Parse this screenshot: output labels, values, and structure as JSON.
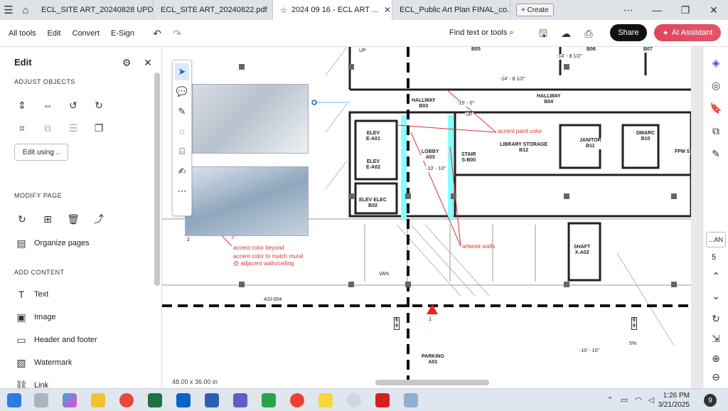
{
  "tabs": [
    {
      "label": "ECL_SITE ART_20240828 UPD...",
      "active": false
    },
    {
      "label": "ECL_SITE ART_20240822.pdf",
      "active": false
    },
    {
      "label": "2024 09 16 - ECL ART ...",
      "active": true
    },
    {
      "label": "ECL_Public Art Plan FINAL_co...",
      "active": false
    }
  ],
  "create_label": "Create",
  "toolbar": {
    "menus": [
      "All tools",
      "Edit",
      "Convert",
      "E-Sign"
    ],
    "find_label": "Find text or tools",
    "share_label": "Share",
    "ai_label": "AI Assistant"
  },
  "left_panel": {
    "title": "Edit",
    "adjust_objects": "ADJUST OBJECTS",
    "edit_using": "Edit using ..",
    "modify_page": "MODIFY PAGE",
    "organize_pages": "Organize pages",
    "add_content": "ADD CONTENT",
    "items": [
      "Text",
      "Image",
      "Header and footer",
      "Watermark",
      "Link"
    ]
  },
  "drawing": {
    "rooms": [
      {
        "name": "HALLWAY",
        "code": "B03"
      },
      {
        "name": "HALLWAY",
        "code": "B04"
      },
      {
        "name": "ELEV",
        "code": "E-A01"
      },
      {
        "name": "ELEV",
        "code": "E-A02"
      },
      {
        "name": "LOBBY",
        "code": "A03"
      },
      {
        "name": "STAIR",
        "code": "S-B00"
      },
      {
        "name": "LIBRARY STORAGE",
        "code": "B12"
      },
      {
        "name": "JANITOR",
        "code": "B11"
      },
      {
        "name": "DMARC",
        "code": "B10"
      },
      {
        "name": "FPM S",
        "code": ""
      },
      {
        "name": "ELEV ELEC",
        "code": "B02"
      },
      {
        "name": "SHAFT",
        "code": "X-A02"
      },
      {
        "name": "PARKING",
        "code": "A01"
      },
      {
        "name": "",
        "code": "B05"
      },
      {
        "name": "",
        "code": "B06"
      },
      {
        "name": "",
        "code": "B07"
      }
    ],
    "annotations": {
      "accent_paint": "accent paint color",
      "artwork_walls": "artwork walls",
      "accent_beyond": "accent color beyond",
      "accent_match": "accent color to match mural @ adjacent walls/ceiling"
    },
    "dims": [
      "-14' - 8 1/2\"",
      "-14' - 8 1/2\"",
      "-15' - 0\"",
      "-10' - 10\"",
      "-10' - 10\""
    ],
    "up_labels": [
      "UP",
      "UP"
    ],
    "misc": {
      "asi": "ASI-004",
      "van": "VAN",
      "grade": "5%",
      "marker": "1",
      "photo_num": "2",
      "grid_a": "6",
      "grid_b": "9"
    },
    "page_size": "48.00 x 36.00 in"
  },
  "right_rail": {
    "page_label": "...AN",
    "page_number": "5"
  },
  "taskbar": {
    "time": "1:26 PM",
    "date": "3/21/2025",
    "notifications": "9"
  },
  "colors": {
    "accent_red": "#dd3344",
    "ai_pink": "#e0465e",
    "selection_blue": "#1a5fd0"
  }
}
